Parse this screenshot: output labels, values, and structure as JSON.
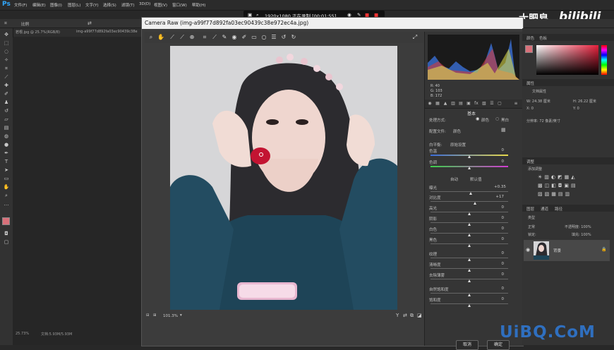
{
  "app": {
    "name": "Ps",
    "accent": "#31a8ff"
  },
  "menubar": {
    "items": [
      "文件(F)",
      "编辑(E)",
      "图像(I)",
      "图层(L)",
      "文字(Y)",
      "选择(S)",
      "滤镜(T)",
      "3D(D)",
      "视图(V)",
      "窗口(W)",
      "帮助(H)"
    ]
  },
  "recorder": {
    "text": "1920x1080 正在录制 [00:01:55]"
  },
  "optbar": {
    "style_label": "比例"
  },
  "doc_tabs": [
    "若根.jpg @ 25.7%(RGB/8)",
    "img-a99f77d892fa03ec90439c38e"
  ],
  "status": {
    "zoom": "25.73%",
    "doc": "文档:5.93M/5.93M"
  },
  "camera_raw": {
    "title": "Camera Raw (img-a99f77d892fa03ec90439c38e972ec4a.jpg)",
    "zoom_value": "101.3%",
    "rgb": {
      "r": "R: 40",
      "g": "G: 103",
      "b": "B: 172"
    },
    "panel_title": "基本",
    "treatment_label": "处理方式:",
    "treatment_color": "颜色",
    "treatment_bw": "黑白",
    "profile_label": "配置文件:",
    "profile_value": "颜色",
    "wb_label": "白平衡:",
    "wb_value": "原始设置",
    "auto_label": "自动",
    "default_label": "默认值",
    "sliders": [
      {
        "label": "色温",
        "value": "0"
      },
      {
        "label": "色调",
        "value": "0"
      },
      {
        "label": "曝光",
        "value": "+0.35"
      },
      {
        "label": "对比度",
        "value": "+17"
      },
      {
        "label": "高光",
        "value": "0"
      },
      {
        "label": "阴影",
        "value": "0"
      },
      {
        "label": "白色",
        "value": "0"
      },
      {
        "label": "黑色",
        "value": "0"
      },
      {
        "label": "纹理",
        "value": "0"
      },
      {
        "label": "清晰度",
        "value": "0"
      },
      {
        "label": "去除薄雾",
        "value": "0"
      },
      {
        "label": "自然饱和度",
        "value": "0"
      },
      {
        "label": "饱和度",
        "value": "0"
      }
    ],
    "slider_levels": [
      0.5,
      0.5,
      0.52,
      0.58,
      0.5,
      0.5,
      0.5,
      0.5,
      0.5,
      0.5,
      0.5,
      0.5,
      0.5
    ],
    "cancel_label": "取消",
    "ok_label": "确定"
  },
  "right_panels": {
    "color_tabs": [
      "颜色",
      "色板"
    ],
    "properties_title": "属性",
    "doc_props": "文档属性",
    "width": "W: 24.38 厘米",
    "height": "H: 26.22 厘米",
    "x": "X: 0",
    "y": "Y: 0",
    "resolution": "分辨率: 72 像素/英寸",
    "adjust_title": "调整",
    "add_adjust": "添加调整",
    "layer_tabs": [
      "图层",
      "通道",
      "路径"
    ],
    "kind_label": "类型",
    "blend_mode": "正常",
    "opacity": "不透明度: 100%",
    "lock": "锁定:",
    "fill": "填充: 100%",
    "layer_name": "背景"
  },
  "watermark": "UiBQ.CoM",
  "brand": "大肥皂",
  "bili": "bilibili",
  "colors": {
    "foreground": "#d9707a",
    "lip": "#c31432"
  }
}
